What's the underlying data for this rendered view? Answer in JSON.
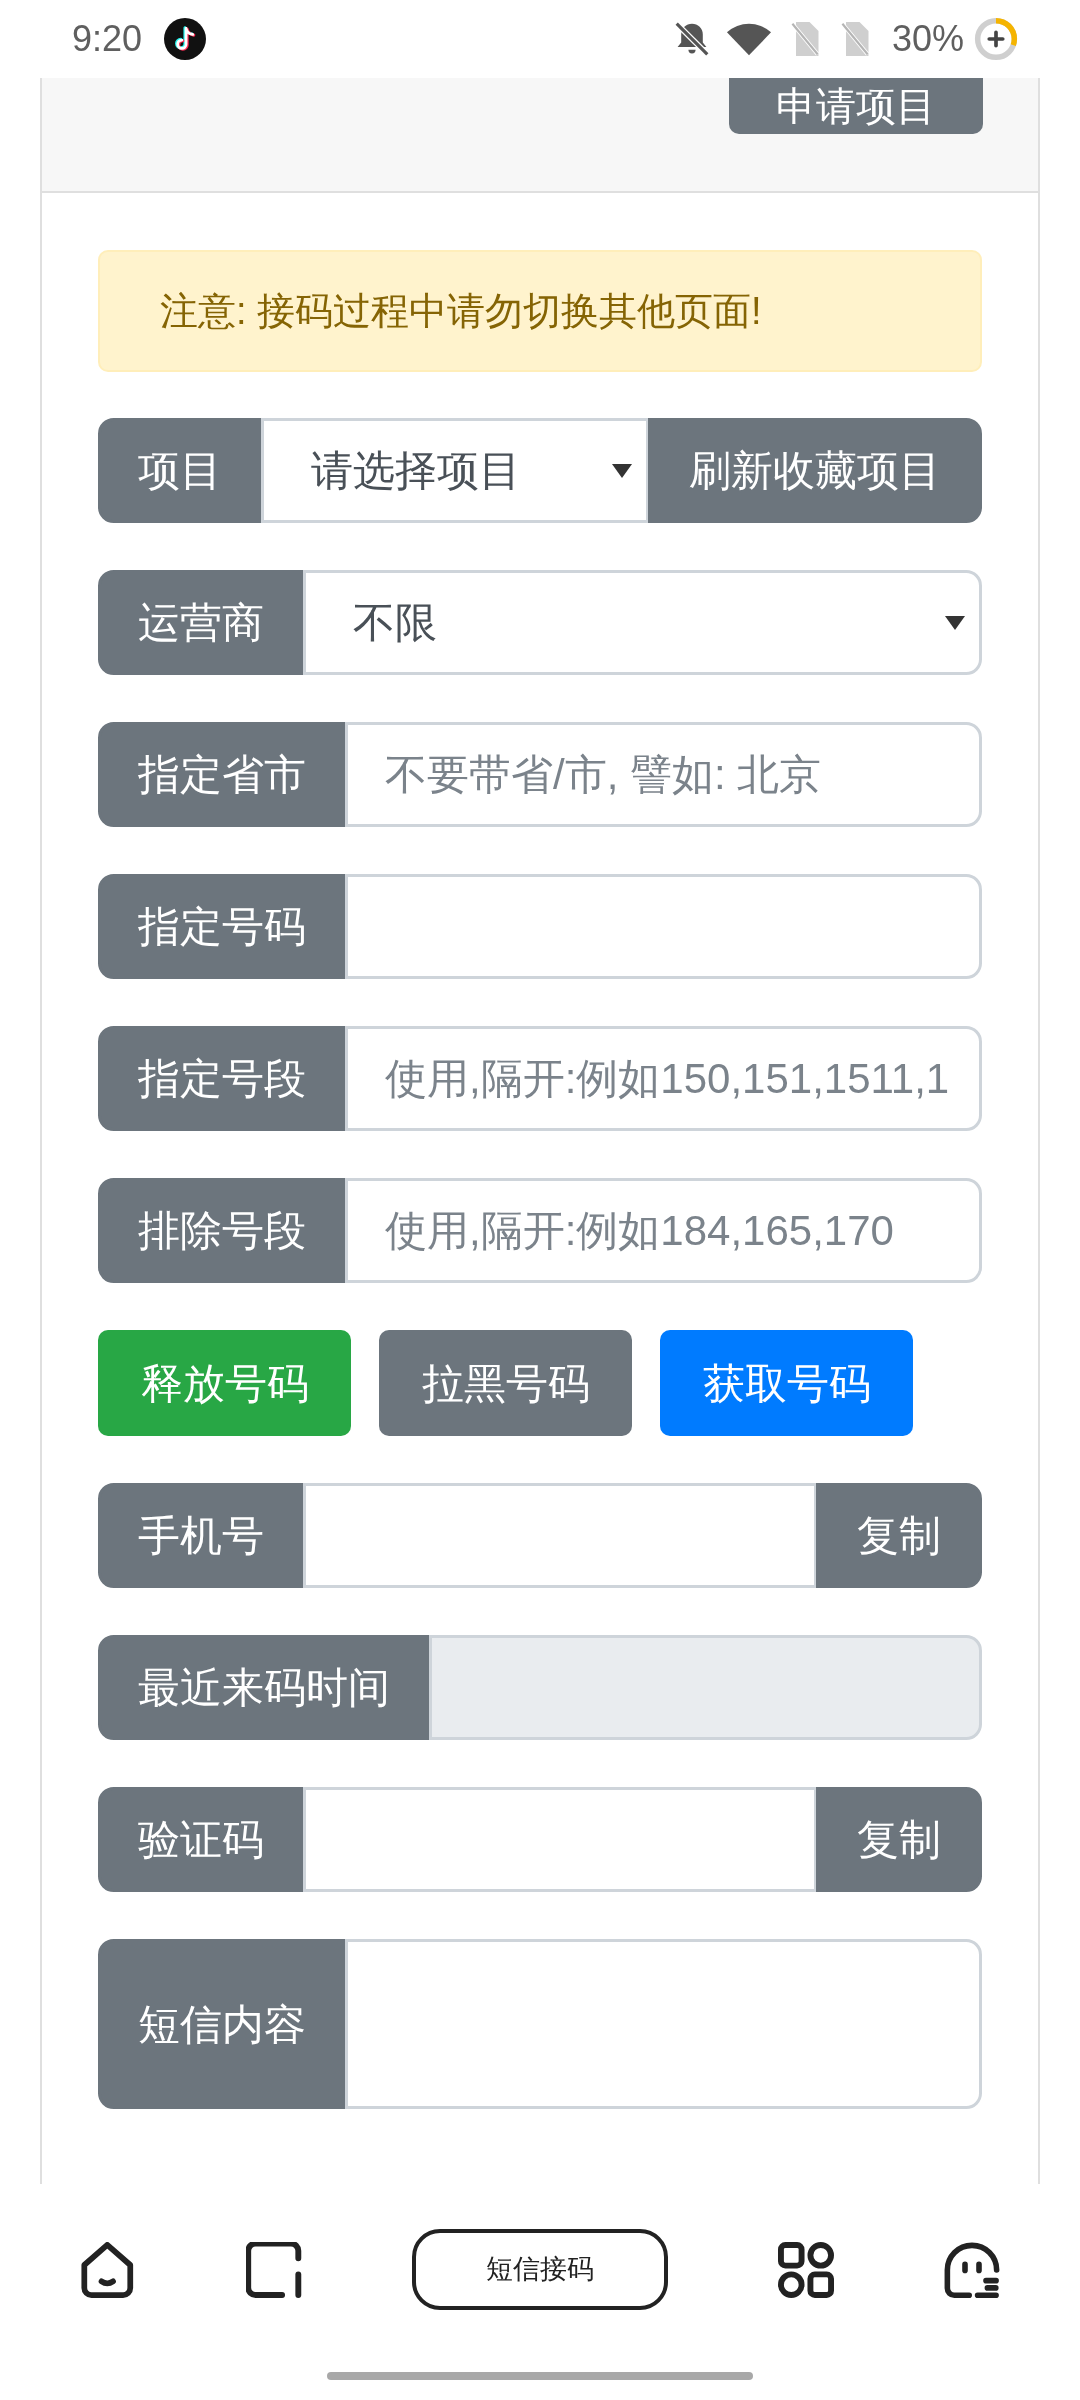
{
  "status_bar": {
    "time": "9:20",
    "battery": "30%"
  },
  "card_header": {
    "button": "申请项目"
  },
  "alert": {
    "text": "注意: 接码过程中请勿切换其他页面!"
  },
  "form_rows": [
    {
      "kind": "select",
      "label": "项目",
      "value": "请选择项目",
      "button": "刷新收藏项目"
    },
    {
      "kind": "select",
      "label": "运营商",
      "value": "不限"
    },
    {
      "kind": "input",
      "label": "指定省市",
      "placeholder": "不要带省/市, 譬如: 北京",
      "disabled": false
    },
    {
      "kind": "input",
      "label": "指定号码",
      "disabled": false
    },
    {
      "kind": "input",
      "label": "指定号段",
      "placeholder": "使用,隔开:例如150,151,1511,1",
      "disabled": false
    },
    {
      "kind": "input",
      "label": "排除号段",
      "placeholder": "使用,隔开:例如184,165,170",
      "disabled": false
    },
    {
      "kind": "actions",
      "buttons": [
        {
          "label": "释放号码",
          "color": "#28a745"
        },
        {
          "label": "拉黑号码",
          "color": "#6c757d"
        },
        {
          "label": "获取号码",
          "color": "#007bff"
        }
      ]
    },
    {
      "kind": "input",
      "label": "手机号",
      "button": "复制",
      "disabled": false
    },
    {
      "kind": "input",
      "label": "最近来码时间",
      "disabled": true
    },
    {
      "kind": "input",
      "label": "验证码",
      "button": "复制",
      "disabled": false
    },
    {
      "kind": "textarea",
      "label": "短信内容"
    }
  ],
  "bottom_nav": {
    "title": "短信接码"
  }
}
